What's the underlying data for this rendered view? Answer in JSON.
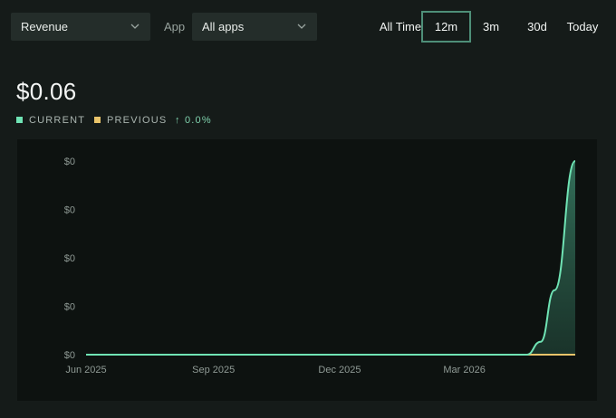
{
  "filters": {
    "metric_select": "Revenue",
    "app_label": "App",
    "app_select": "All apps"
  },
  "time_ranges": [
    {
      "label": "All Time",
      "active": false
    },
    {
      "label": "12m",
      "active": true
    },
    {
      "label": "3m",
      "active": false
    },
    {
      "label": "30d",
      "active": false
    },
    {
      "label": "Today",
      "active": false
    }
  ],
  "summary": {
    "value": "$0.06",
    "legend_current": "CURRENT",
    "legend_previous": "PREVIOUS",
    "change": "↑ 0.0%"
  },
  "colors": {
    "current": "#6fe3b4",
    "previous": "#e9c46a",
    "accent_border": "#4e8f78",
    "change": "#7fd1ad"
  },
  "chart_data": {
    "type": "area",
    "y_tick_labels": [
      "$0",
      "$0",
      "$0",
      "$0",
      "$0"
    ],
    "x_tick_labels": [
      "Jun 2025",
      "Sep 2025",
      "Dec 2025",
      "Mar 2026"
    ],
    "x_range": [
      "2025-06-01",
      "2026-05-20"
    ],
    "ylim": [
      0,
      0.06
    ],
    "grid": false,
    "series": [
      {
        "name": "CURRENT",
        "x": [
          "2025-06-01",
          "2026-04-15",
          "2026-04-25",
          "2026-05-05",
          "2026-05-20"
        ],
        "values": [
          0,
          0,
          0.004,
          0.02,
          0.06
        ]
      },
      {
        "name": "PREVIOUS",
        "x": [
          "2026-04-15",
          "2026-05-20"
        ],
        "values": [
          0,
          0
        ]
      }
    ]
  }
}
